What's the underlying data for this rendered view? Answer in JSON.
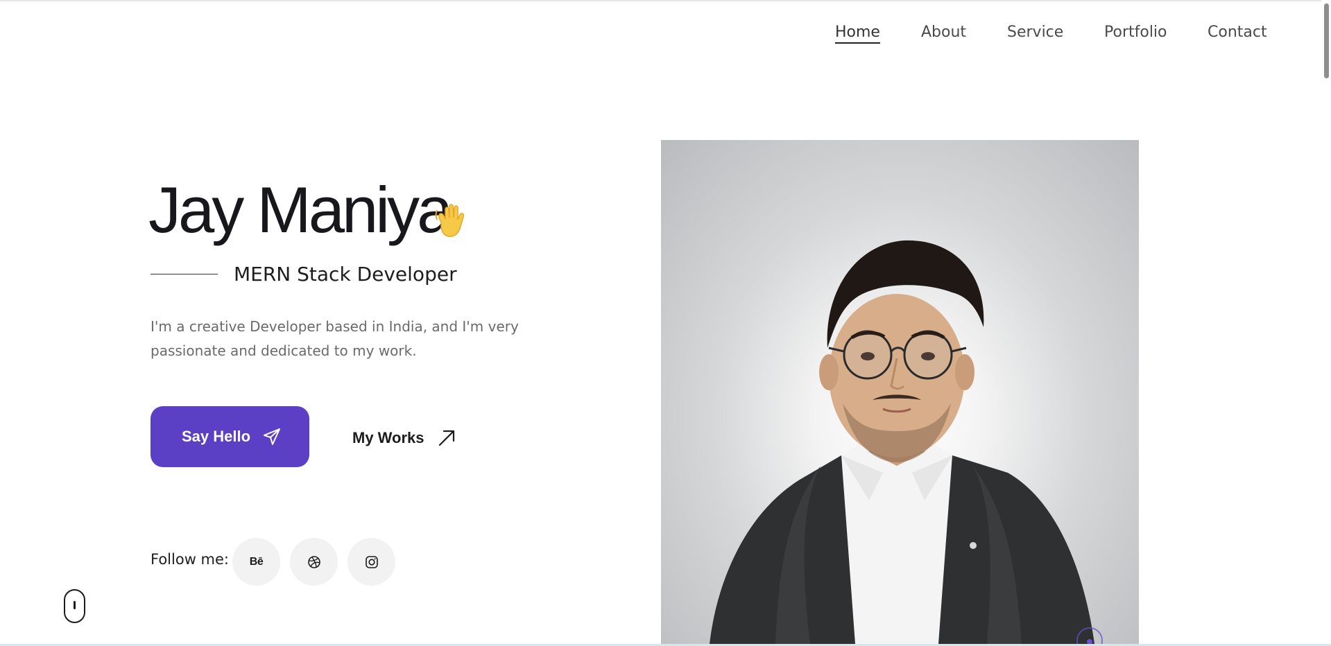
{
  "nav": {
    "items": [
      {
        "label": "Home",
        "active": true
      },
      {
        "label": "About",
        "active": false
      },
      {
        "label": "Service",
        "active": false
      },
      {
        "label": "Portfolio",
        "active": false
      },
      {
        "label": "Contact",
        "active": false
      }
    ]
  },
  "hero": {
    "name": "Jay Maniya",
    "wave_icon": "waving-hand-emoji",
    "subtitle": "MERN Stack Developer",
    "description": "I'm a creative Developer based in India, and I'm very passionate and dedicated to my work."
  },
  "buttons": {
    "say_hello": "Say Hello",
    "say_hello_icon": "paper-plane-icon",
    "my_works": "My Works",
    "my_works_icon": "arrow-up-right-icon"
  },
  "follow": {
    "label": "Follow me:",
    "socials": [
      {
        "name": "behance",
        "text": "Bē"
      },
      {
        "name": "dribbble",
        "text": ""
      },
      {
        "name": "instagram",
        "text": ""
      }
    ]
  },
  "colors": {
    "accent": "#5b3fc4",
    "text": "#17171c",
    "muted": "#6a6a6a",
    "social_bg": "#f2f2f2"
  }
}
